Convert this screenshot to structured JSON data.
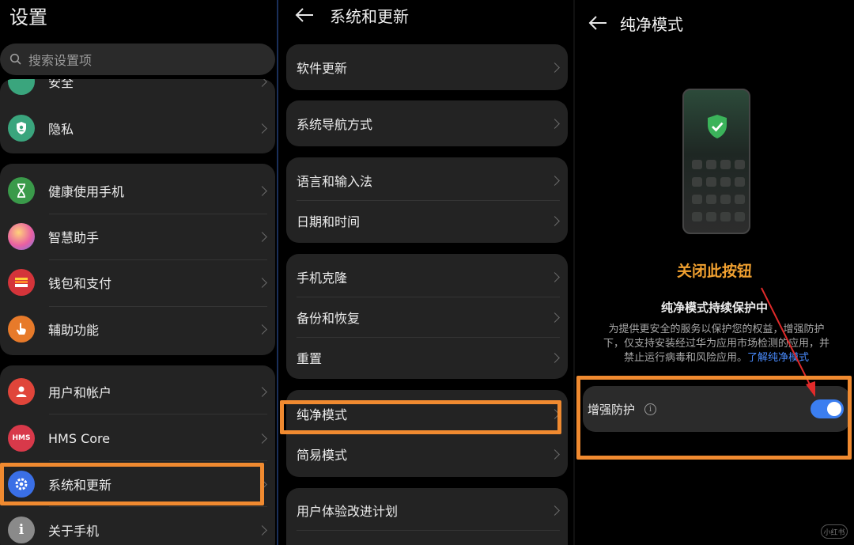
{
  "settings": {
    "title": "设置",
    "search_placeholder": "搜索设置项",
    "partial_item": "安全",
    "privacy": "隐私",
    "group2": [
      "健康使用手机",
      "智慧助手",
      "钱包和支付",
      "辅助功能"
    ],
    "group3": [
      "用户和帐户",
      "HMS Core",
      "系统和更新",
      "关于手机"
    ],
    "hms_icon_text": "HMS"
  },
  "system": {
    "title": "系统和更新",
    "items": [
      "软件更新",
      "系统导航方式",
      "语言和输入法",
      "日期和时间",
      "手机克隆",
      "备份和恢复",
      "重置",
      "纯净模式",
      "简易模式",
      "用户体验改进计划"
    ]
  },
  "pure": {
    "title": "纯净模式",
    "annotation": "关闭此按钮",
    "status": "纯净模式持续保护中",
    "desc_line1": "为提供更安全的服务以保护您的权益，增强防护",
    "desc_line2": "下，仅支持安装经过华为应用市场检测的应用，并",
    "desc_line3": "禁止运行病毒和风险应用。",
    "desc_link": "了解纯净模式",
    "toggle_label": "增强防护",
    "toggle_on": true
  },
  "watermark": "小红书",
  "colors": {
    "highlight": "#f08a30",
    "toggle": "#3b7ef0",
    "accent_text": "#f0a030",
    "link": "#4a8cff"
  }
}
